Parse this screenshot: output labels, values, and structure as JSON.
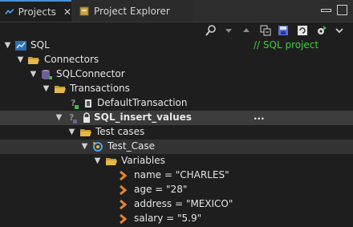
{
  "tabs": {
    "projects": "Projects",
    "explorer": "Project Explorer"
  },
  "colors": {
    "comment": "#3fcf3f",
    "folder": "#e8b84a",
    "accent": "#4a8fd9"
  },
  "tree": {
    "sql": {
      "label": "SQL",
      "comment": "// SQL project"
    },
    "connectors": "Connectors",
    "sqlconnector": "SQLConnector",
    "transactions": "Transactions",
    "default_txn": "DefaultTransaction",
    "sql_insert": {
      "label": "SQL_insert_values",
      "more": "..."
    },
    "test_cases": "Test cases",
    "test_case": "Test_Case",
    "variables": "Variables",
    "vars": [
      "name = \"CHARLES\"",
      "age = \"28\"",
      "address = \"MEXICO\"",
      "salary = \"5.9\""
    ]
  }
}
